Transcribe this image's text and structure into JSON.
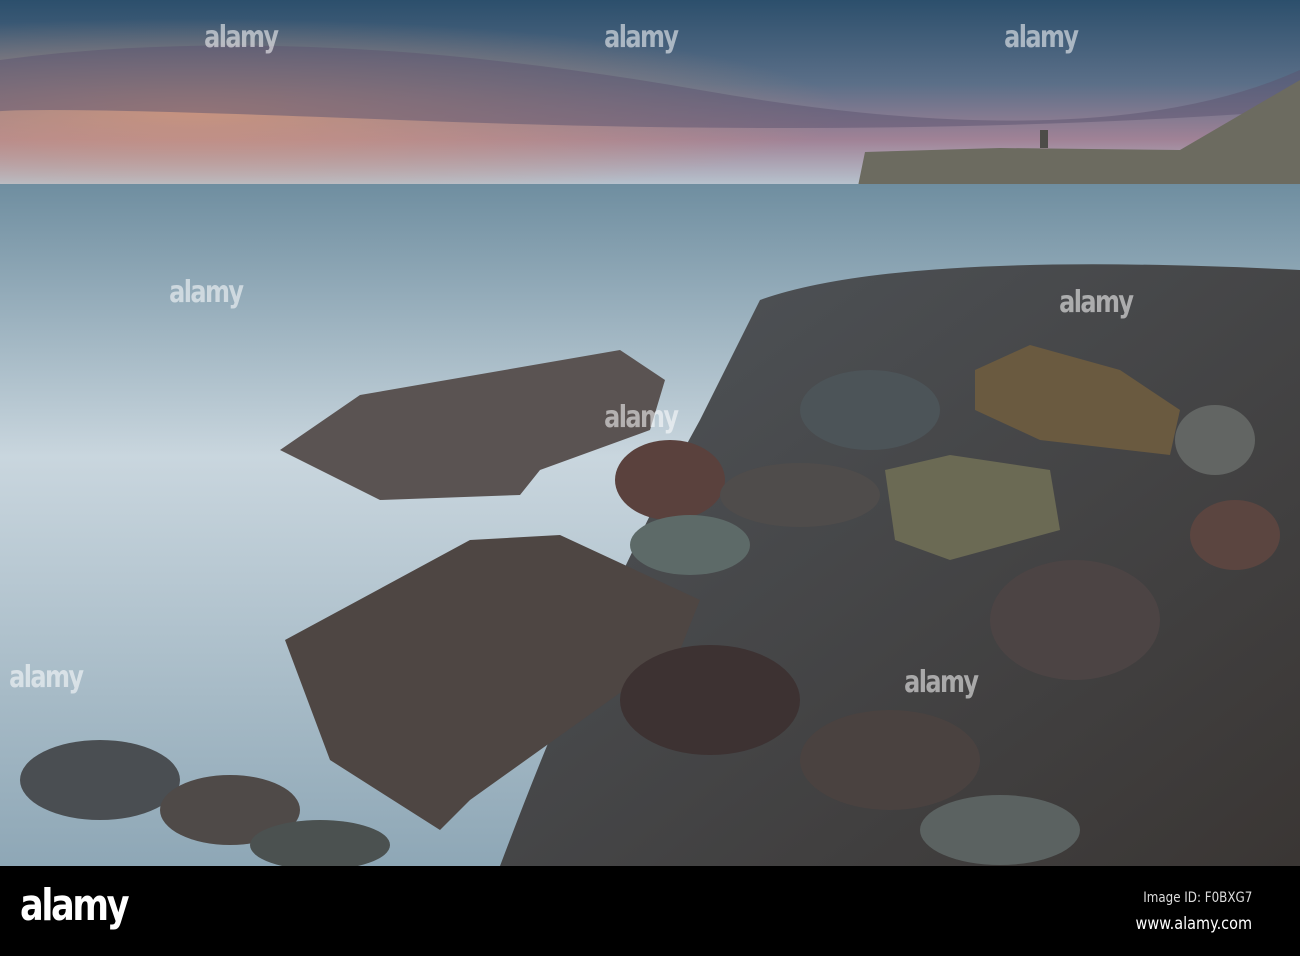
{
  "watermark": {
    "logo": "alamy",
    "image_id": "Image ID: F0BXG7",
    "url": "www.alamy.com"
  },
  "colors": {
    "sky_top": "#2f5f7e",
    "sky_glow": "#c98a74",
    "sea": "#9fb7c4",
    "rock": "#4f4a48",
    "bar": "#000000"
  }
}
